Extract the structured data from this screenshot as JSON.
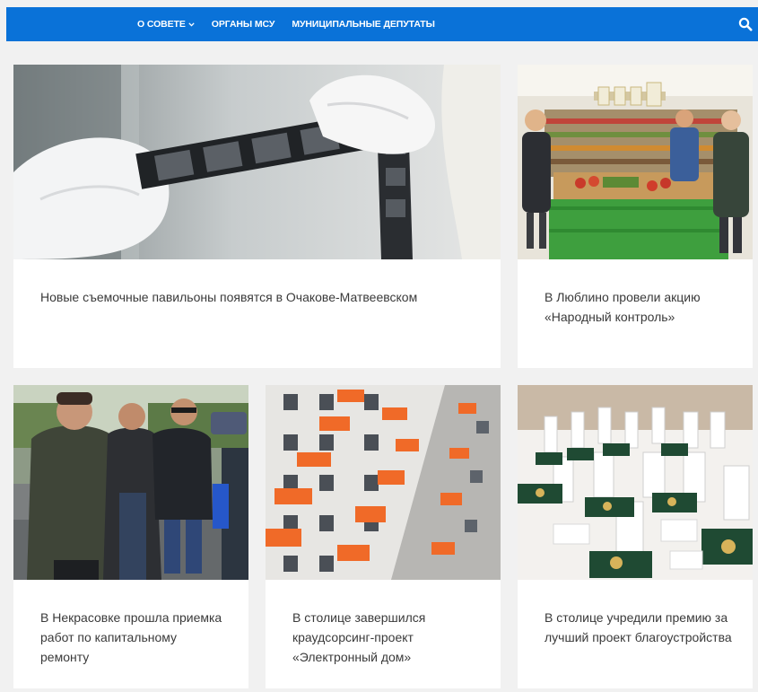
{
  "nav": {
    "items": [
      {
        "label": "О СОВЕТЕ",
        "has_dropdown": true
      },
      {
        "label": "ОРГАНЫ МСУ",
        "has_dropdown": false
      },
      {
        "label": "МУНИЦИПАЛЬНЫЕ ДЕПУТАТЫ",
        "has_dropdown": false
      }
    ],
    "search_icon": "search-icon",
    "bar_color": "#0a72d8"
  },
  "news": [
    {
      "title": "Новые съемочные павильоны появятся в Очакове-Матвеевском",
      "image": "film-strip-gloves-photo"
    },
    {
      "title": "В Люблино провели акцию «Народный контроль»",
      "image": "supermarket-inspection-photo"
    },
    {
      "title": "В Некрасовке прошла приемка работ по капитальному ремонту",
      "image": "officials-outdoor-photo"
    },
    {
      "title": "В столице завершился краудсорсинг-проект «Электронный дом»",
      "image": "apartment-building-photo"
    },
    {
      "title": "В столице учредили премию за лучший проект благоустройства",
      "image": "award-medals-photo"
    }
  ]
}
